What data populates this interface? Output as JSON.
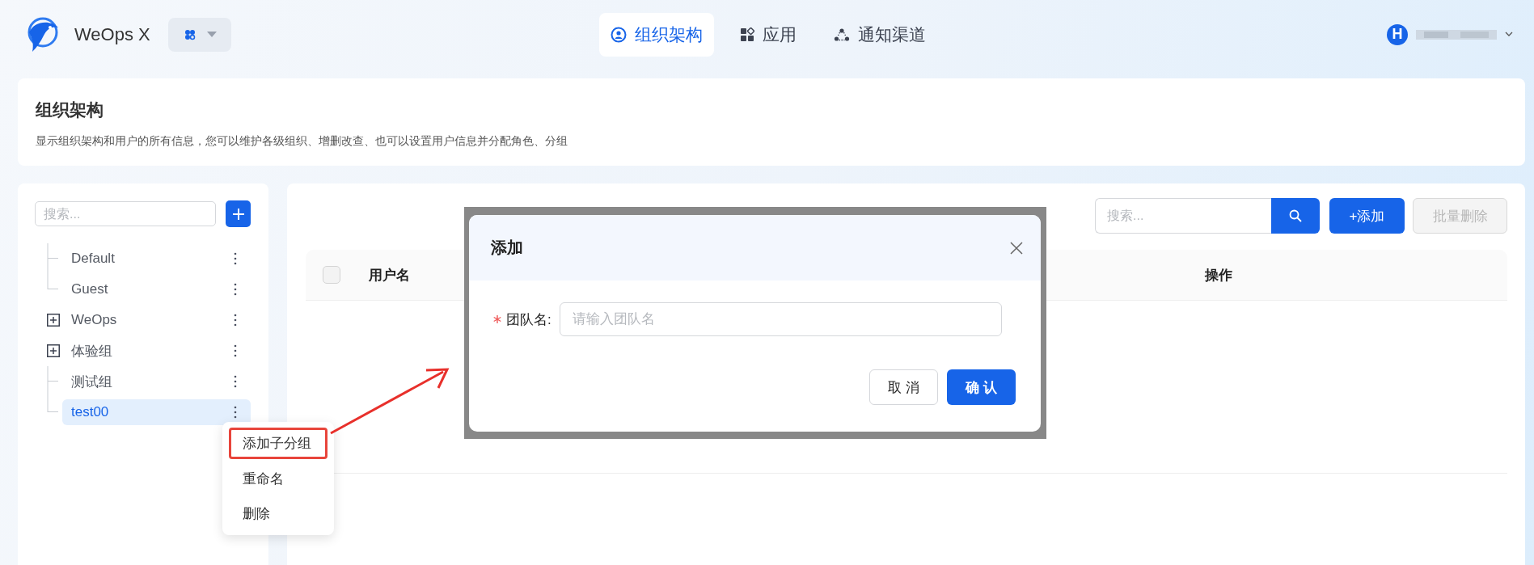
{
  "header": {
    "app_name": "WeOps X",
    "nav": [
      {
        "label": "组织架构",
        "selected": true
      },
      {
        "label": "应用",
        "selected": false
      },
      {
        "label": "通知渠道",
        "selected": false
      }
    ],
    "user": {
      "avatar": "H"
    }
  },
  "page_header": {
    "title": "组织架构",
    "description": "显示组织架构和用户的所有信息，您可以维护各级组织、增删改查、也可以设置用户信息并分配角色、分组"
  },
  "sidebar": {
    "search": {
      "placeholder": "搜索..."
    },
    "tree": [
      {
        "label": "Default",
        "has_children": false,
        "selected": false
      },
      {
        "label": "Guest",
        "has_children": false,
        "selected": false
      },
      {
        "label": "WeOps",
        "has_children": true,
        "selected": false
      },
      {
        "label": "体验组",
        "has_children": true,
        "selected": false
      },
      {
        "label": "测试组",
        "has_children": false,
        "selected": false
      },
      {
        "label": "test00",
        "has_children": false,
        "selected": true
      }
    ]
  },
  "context_menu": {
    "items": [
      {
        "label": "添加子分组",
        "highlighted": true
      },
      {
        "label": "重命名",
        "highlighted": false
      },
      {
        "label": "删除",
        "highlighted": false
      }
    ]
  },
  "toolbar": {
    "search": {
      "placeholder": "搜索..."
    },
    "buttons": [
      {
        "label": "+添加",
        "disabled": false
      },
      {
        "label": "批量删除",
        "disabled": true
      }
    ]
  },
  "table": {
    "select_all_checked": false,
    "columns": [
      "用户名",
      "操作"
    ]
  },
  "dialog": {
    "title": "添加",
    "field": {
      "label": "团队名:",
      "required": true,
      "placeholder": "请输入团队名"
    },
    "buttons": [
      {
        "label": "取 消",
        "kind": "default"
      },
      {
        "label": "确 认",
        "kind": "primary"
      }
    ]
  }
}
